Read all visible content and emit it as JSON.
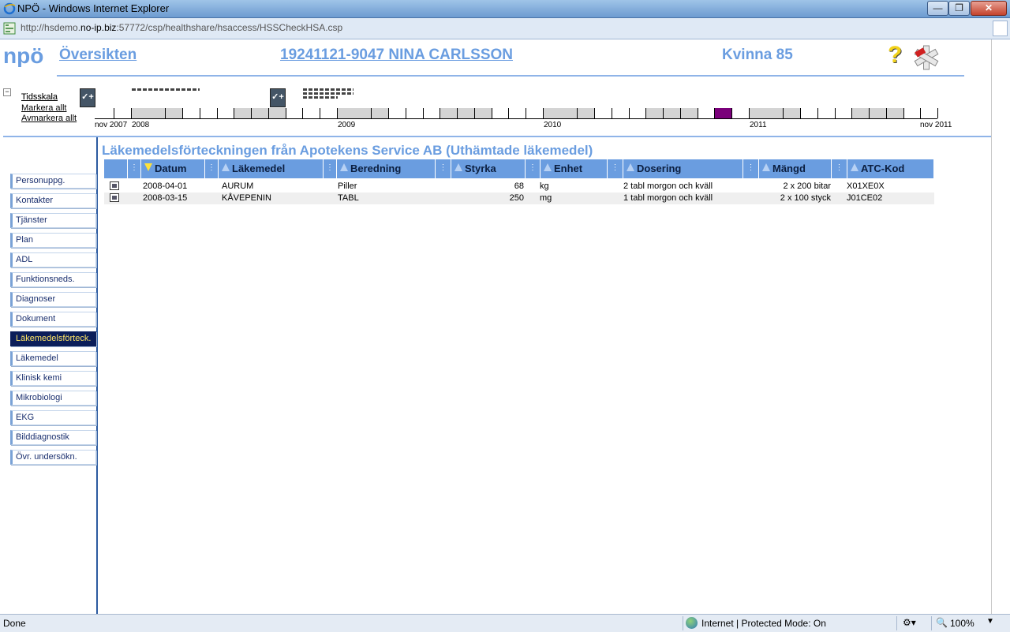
{
  "window": {
    "title": "NPÖ - Windows Internet Explorer"
  },
  "address": {
    "prefix": "http://hsdemo.",
    "host": "no-ip.biz",
    "suffix": ":57772/csp/healthshare/hsaccess/HSSCheckHSA.csp"
  },
  "header": {
    "logo_text": "npö",
    "overview_link": "Översikten",
    "patient_link": "19241121-9047 NINA CARLSSON",
    "gender_age": "Kvinna 85",
    "help_symbol": "?"
  },
  "timeline": {
    "scale_label": "Tidsskala",
    "select_all": "Markera allt",
    "deselect_all": "Avmarkera allt",
    "check_symbol": "✓+",
    "collapse_symbol": "−",
    "labels": [
      "nov 2007",
      "2008",
      "2009",
      "2010",
      "2011",
      "nov 2011"
    ]
  },
  "sidebar": {
    "items": [
      {
        "label": "Personuppg."
      },
      {
        "label": "Kontakter"
      },
      {
        "label": "Tjänster"
      },
      {
        "label": "Plan"
      },
      {
        "label": "ADL"
      },
      {
        "label": "Funktionsneds."
      },
      {
        "label": "Diagnoser"
      },
      {
        "label": "Dokument"
      },
      {
        "label": "Läkemedelsförteck."
      },
      {
        "label": "Läkemedel"
      },
      {
        "label": "Klinisk kemi"
      },
      {
        "label": "Mikrobiologi"
      },
      {
        "label": "EKG"
      },
      {
        "label": "Bilddiagnostik"
      },
      {
        "label": "Övr. undersökn."
      }
    ],
    "active_index": 8
  },
  "main": {
    "title": "Läkemedelsförteckningen från Apotekens Service AB (Uthämtade läkemedel)",
    "columns": [
      "Datum",
      "Läkemedel",
      "Beredning",
      "Styrka",
      "Enhet",
      "Dosering",
      "Mängd",
      "ATC-Kod"
    ],
    "sorted_column": "Datum",
    "rows": [
      {
        "datum": "2008-04-01",
        "lakemedel": "AURUM",
        "beredning": "Piller",
        "styrka": "68",
        "enhet": "kg",
        "dosering": "2 tabl morgon och kväll",
        "mangd": "2 x 200 bitar",
        "atc": "X01XE0X"
      },
      {
        "datum": "2008-03-15",
        "lakemedel": "KÅVEPENIN",
        "beredning": "TABL",
        "styrka": "250",
        "enhet": "mg",
        "dosering": "1 tabl morgon och kväll",
        "mangd": "2 x 100 styck",
        "atc": "J01CE02"
      }
    ]
  },
  "status": {
    "left": "Done",
    "zone": "Internet | Protected Mode: On",
    "zoom": "100%"
  },
  "colors": {
    "accent": "#6a9de0",
    "active_nav_bg": "#0b1e5a",
    "active_nav_text": "#ffe566",
    "timeline_highlight": "#7a007a"
  }
}
